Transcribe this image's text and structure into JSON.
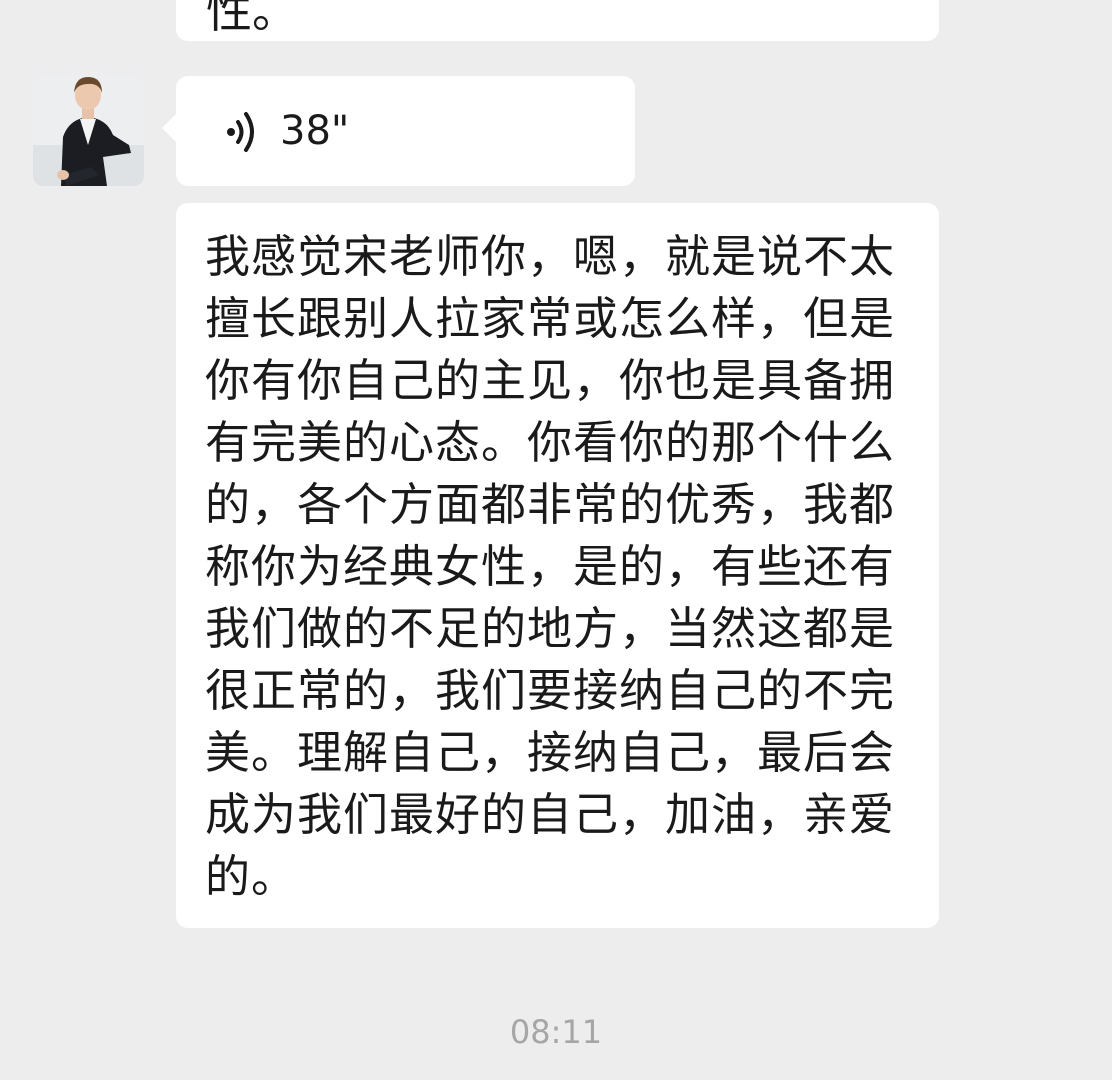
{
  "previous_message": {
    "visible_fragment": "性。"
  },
  "voice_message": {
    "duration": "38\""
  },
  "text_message": {
    "lines": [
      "我感觉宋老师你，嗯，就是说不太",
      "擅长跟别人拉家常或怎么样，但是",
      "你有你自己的主见，你也是具备拥",
      "有完美的心态。你看你的那个什么",
      "的，各个方面都非常的优秀，我都",
      "称你为经典女性，是的，有些还有",
      "我们做的不足的地方，当然这都是",
      "很正常的，我们要接纳自己的不完",
      "美。理解自己，接纳自己，最后会",
      "成为我们最好的自己，加油，亲爱",
      "的。"
    ]
  },
  "timestamp": "08:11",
  "colors": {
    "background": "#ededed",
    "bubble": "#ffffff",
    "text": "#1a1a1a",
    "timestamp": "#a6a6a6"
  }
}
